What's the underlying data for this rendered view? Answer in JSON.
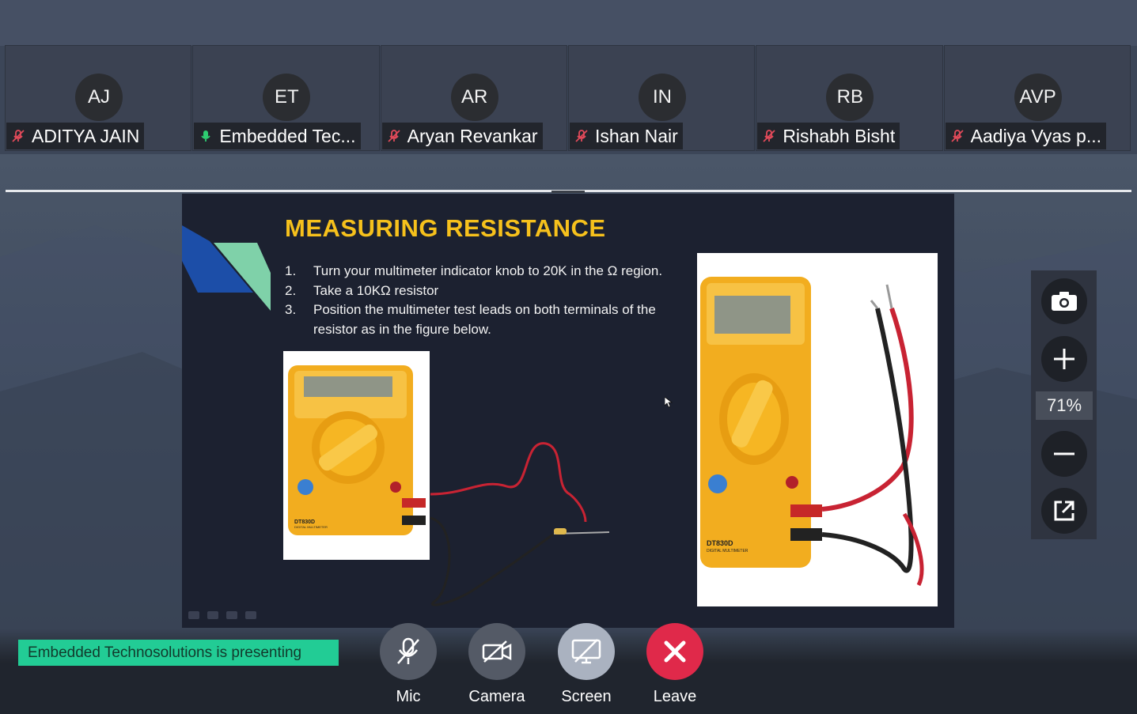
{
  "participants": [
    {
      "initials": "AJ",
      "name": "ADITYA JAIN",
      "mic": "muted"
    },
    {
      "initials": "ET",
      "name": "Embedded Tec...",
      "mic": "active"
    },
    {
      "initials": "AR",
      "name": "Aryan Revankar",
      "mic": "muted"
    },
    {
      "initials": "IN",
      "name": "Ishan Nair",
      "mic": "muted"
    },
    {
      "initials": "RB",
      "name": "Rishabh Bisht",
      "mic": "muted"
    },
    {
      "initials": "AVP",
      "name": "Aadiya Vyas p...",
      "mic": "muted"
    }
  ],
  "slide": {
    "title": "MEASURING RESISTANCE",
    "steps": [
      {
        "num": "1.",
        "text": "Turn your multimeter indicator knob to 20K in the Ω region."
      },
      {
        "num": "2.",
        "text": "Take a 10KΩ resistor"
      },
      {
        "num": "3.",
        "text": "Position the multimeter test leads on both terminals of the resistor as in the figure below."
      }
    ],
    "meter_model": "DT830D",
    "meter_caption": "DIGITAL MULTIMETER"
  },
  "zoom": {
    "level": "71%"
  },
  "presenting_banner": "Embedded Technosolutions  is presenting",
  "controls": {
    "mic_label": "Mic",
    "camera_label": "Camera",
    "screen_label": "Screen",
    "leave_label": "Leave"
  },
  "colors": {
    "accent_green": "#22cc95",
    "leave_red": "#e0294a",
    "title_yellow": "#f6c11c",
    "muted_red": "#e24a5a",
    "mic_green": "#2ecc71"
  }
}
